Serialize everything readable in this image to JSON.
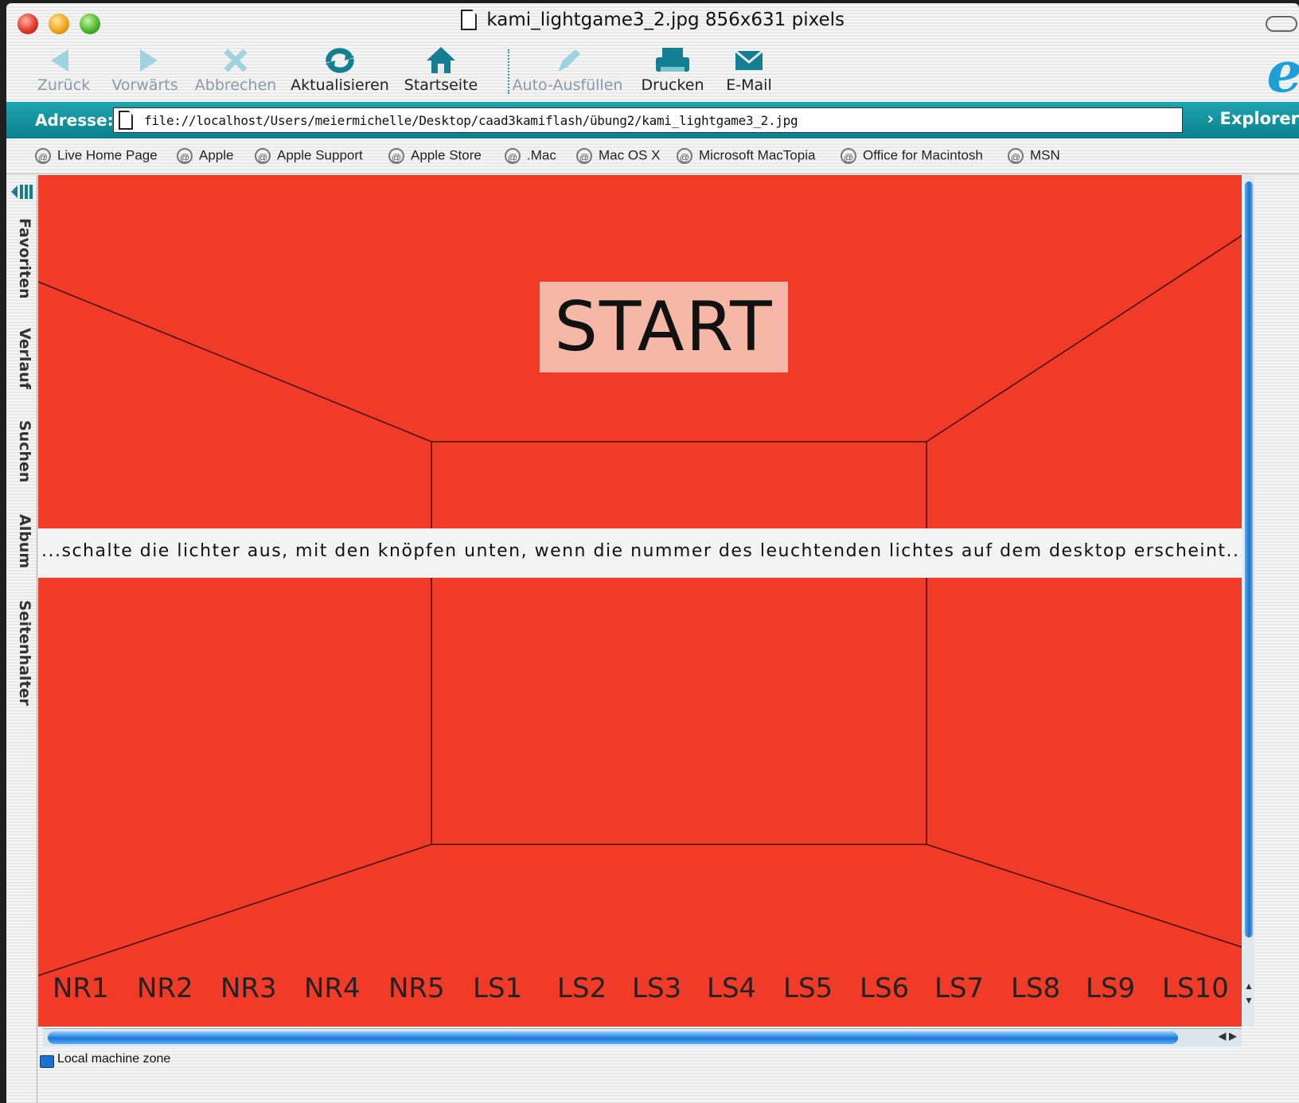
{
  "window": {
    "title": "kami_lightgame3_2.jpg 856x631 pixels"
  },
  "toolbar": {
    "back": "Zurück",
    "forward": "Vorwärts",
    "stop": "Abbrechen",
    "refresh": "Aktualisieren",
    "home": "Startseite",
    "autofill": "Auto-Ausfüllen",
    "print": "Drucken",
    "mail": "E-Mail"
  },
  "address": {
    "label": "Adresse:",
    "url": "file://localhost/Users/meiermichelle/Desktop/caad3kamiflash/übung2/kami_lightgame3_2.jpg",
    "explorer": "Explorer"
  },
  "favorites": [
    "Live Home Page",
    "Apple",
    "Apple Support",
    "Apple Store",
    ".Mac",
    "Mac OS X",
    "Microsoft MacTopia",
    "Office for Macintosh",
    "MSN"
  ],
  "sidebar": {
    "tabs": [
      "Favoriten",
      "Verlauf",
      "Suchen",
      "Album",
      "Seitenhalter"
    ]
  },
  "game": {
    "start_label": "START",
    "instruction": "...schalte die lichter aus, mit den knöpfen unten,  wenn die nummer des leuchtenden lichtes auf dem desktop erscheint......",
    "buttons": [
      "NR1",
      "NR2",
      "NR3",
      "NR4",
      "NR5",
      "LS1",
      "LS2",
      "LS3",
      "LS4",
      "LS5",
      "LS6",
      "LS7",
      "LS8",
      "LS9",
      "LS10"
    ],
    "background_color": "#ef3b27",
    "start_color": "#f6b8a6"
  },
  "status": {
    "zone": "Local machine zone"
  },
  "icons": {
    "back": "back-arrow-icon",
    "forward": "forward-arrow-icon",
    "stop": "stop-x-icon",
    "refresh": "refresh-icon",
    "home": "home-icon",
    "autofill": "autofill-icon",
    "print": "printer-icon",
    "mail": "envelope-icon",
    "favorite": "at-sign-icon",
    "browser": "internet-explorer-logo"
  }
}
